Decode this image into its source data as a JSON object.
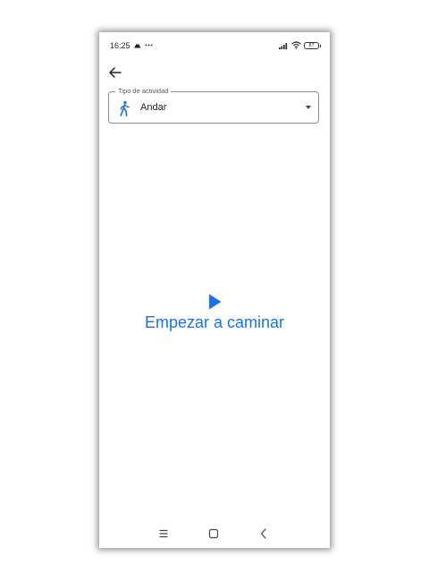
{
  "status_bar": {
    "time": "16:25",
    "battery_level": "87",
    "icons": [
      "navigation-icon",
      "more-dots-icon",
      "signal-icon",
      "wifi-icon",
      "battery-icon"
    ]
  },
  "header": {
    "back_icon": "arrow-back-icon"
  },
  "activity_select": {
    "label": "Tipo de actividad",
    "value": "Andar",
    "icon": "walking-person-icon"
  },
  "start": {
    "label": "Empezar a caminar",
    "icon": "play-icon"
  },
  "nav_bar": {
    "icons": [
      "menu-icon",
      "home-icon",
      "back-chevron-icon"
    ]
  },
  "colors": {
    "accent": "#1a73e8",
    "text": "#202124",
    "outline": "#8c8c8c"
  }
}
